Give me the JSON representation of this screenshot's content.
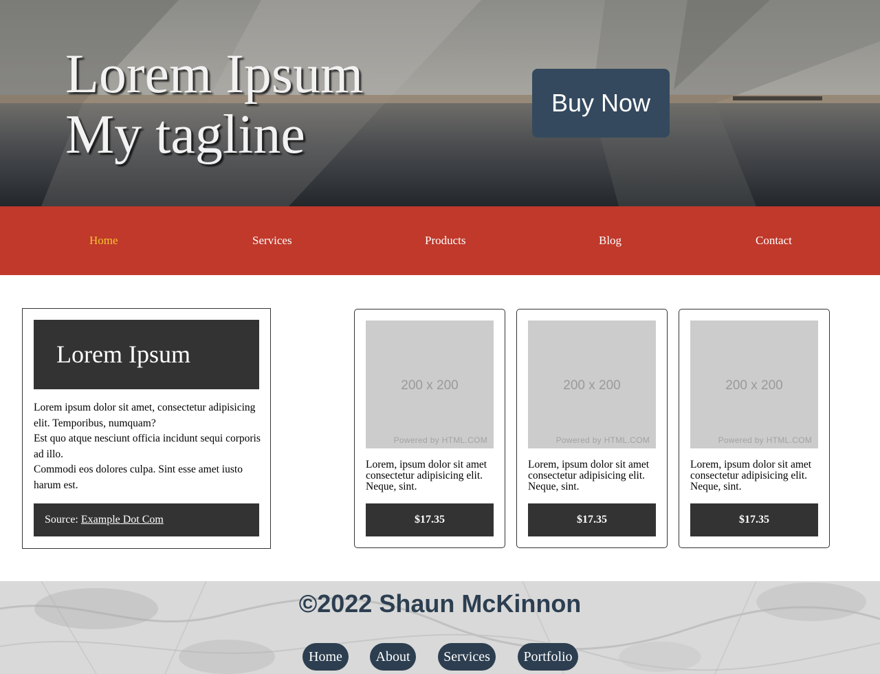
{
  "hero": {
    "title_line1": "Lorem Ipsum",
    "title_line2": "My tagline",
    "buy_button": "Buy Now"
  },
  "nav": {
    "items": [
      {
        "label": "Home",
        "active": true
      },
      {
        "label": "Services",
        "active": false
      },
      {
        "label": "Products",
        "active": false
      },
      {
        "label": "Blog",
        "active": false
      },
      {
        "label": "Contact",
        "active": false
      }
    ]
  },
  "article": {
    "heading": "Lorem Ipsum",
    "paragraph1": "Lorem ipsum dolor sit amet, consectetur adipisicing elit. Temporibus, numquam?",
    "paragraph2": "Est quo atque nesciunt officia incidunt sequi corporis ad illo.",
    "paragraph3": "Commodi eos dolores culpa. Sint esse amet iusto harum est.",
    "source_label": "Source: ",
    "source_link": "Example Dot Com"
  },
  "products": [
    {
      "image_text": "200 x 200",
      "image_credit": "Powered by HTML.COM",
      "description": "Lorem, ipsum dolor sit amet consectetur adipisicing elit. Neque, sint.",
      "price": "$17.35"
    },
    {
      "image_text": "200 x 200",
      "image_credit": "Powered by HTML.COM",
      "description": "Lorem, ipsum dolor sit amet consectetur adipisicing elit. Neque, sint.",
      "price": "$17.35"
    },
    {
      "image_text": "200 x 200",
      "image_credit": "Powered by HTML.COM",
      "description": "Lorem, ipsum dolor sit amet consectetur adipisicing elit. Neque, sint.",
      "price": "$17.35"
    }
  ],
  "footer": {
    "copyright": "©2022 Shaun McKinnon",
    "links": [
      "Home",
      "About",
      "Services",
      "Portfolio"
    ]
  },
  "colors": {
    "nav_bg": "#c0392b",
    "nav_active": "#f4c430",
    "button_dark": "#34495e",
    "card_dark": "#333333",
    "footer_text": "#2c3e50"
  }
}
